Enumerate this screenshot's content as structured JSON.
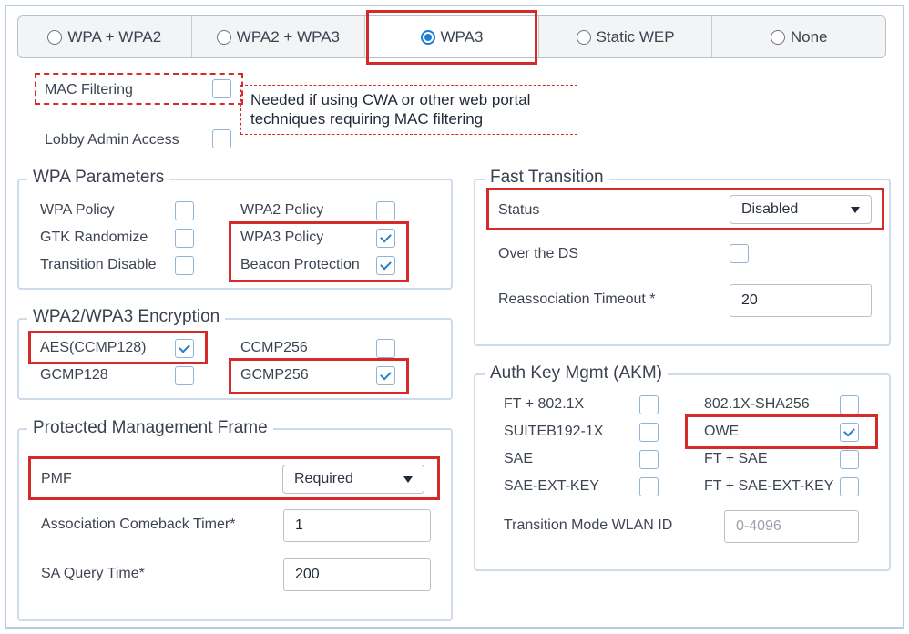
{
  "security_tabs": {
    "items": [
      {
        "label": "WPA + WPA2",
        "selected": false
      },
      {
        "label": "WPA2 + WPA3",
        "selected": false
      },
      {
        "label": "WPA3",
        "selected": true
      },
      {
        "label": "Static WEP",
        "selected": false
      },
      {
        "label": "None",
        "selected": false
      }
    ]
  },
  "top_options": {
    "mac_filtering": {
      "label": "MAC Filtering",
      "checked": false
    },
    "lobby_admin": {
      "label": "Lobby Admin Access",
      "checked": false
    },
    "note": "Needed if using CWA or other web portal techniques requiring MAC filtering"
  },
  "wpa_parameters": {
    "title": "WPA Parameters",
    "wpa_policy": {
      "label": "WPA Policy",
      "checked": false
    },
    "gtk_randomize": {
      "label": "GTK Randomize",
      "checked": false
    },
    "transition_disable": {
      "label": "Transition Disable",
      "checked": false
    },
    "wpa2_policy": {
      "label": "WPA2 Policy",
      "checked": false
    },
    "wpa3_policy": {
      "label": "WPA3 Policy",
      "checked": true
    },
    "beacon_protection": {
      "label": "Beacon Protection",
      "checked": true
    }
  },
  "encryption": {
    "title": "WPA2/WPA3 Encryption",
    "aes_ccmp128": {
      "label": "AES(CCMP128)",
      "checked": true
    },
    "gcmp128": {
      "label": "GCMP128",
      "checked": false
    },
    "ccmp256": {
      "label": "CCMP256",
      "checked": false
    },
    "gcmp256": {
      "label": "GCMP256",
      "checked": true
    }
  },
  "pmf": {
    "title": "Protected Management Frame",
    "pmf_label": "PMF",
    "pmf_value": "Required",
    "comeback_label": "Association Comeback Timer*",
    "comeback_value": "1",
    "sa_query_label": "SA Query Time*",
    "sa_query_value": "200"
  },
  "fast_transition": {
    "title": "Fast Transition",
    "status_label": "Status",
    "status_value": "Disabled",
    "over_ds": {
      "label": "Over the DS",
      "checked": false
    },
    "reassoc_label": "Reassociation Timeout *",
    "reassoc_value": "20"
  },
  "akm": {
    "title": "Auth Key Mgmt (AKM)",
    "ft_8021x": {
      "label": "FT + 802.1X",
      "checked": false
    },
    "suiteb192": {
      "label": "SUITEB192-1X",
      "checked": false
    },
    "sae": {
      "label": "SAE",
      "checked": false
    },
    "sae_ext": {
      "label": "SAE-EXT-KEY",
      "checked": false
    },
    "x8021_sha256": {
      "label": "802.1X-SHA256",
      "checked": false
    },
    "owe": {
      "label": "OWE",
      "checked": true
    },
    "ft_sae": {
      "label": "FT + SAE",
      "checked": false
    },
    "ft_sae_ext": {
      "label": "FT + SAE-EXT-KEY",
      "checked": false
    },
    "transition_wlan_label": "Transition Mode WLAN ID",
    "transition_wlan_placeholder": "0-4096"
  },
  "colors": {
    "accent": "#1c7fd4",
    "highlight": "#d42a2a",
    "group_border": "#cfdbe8"
  }
}
